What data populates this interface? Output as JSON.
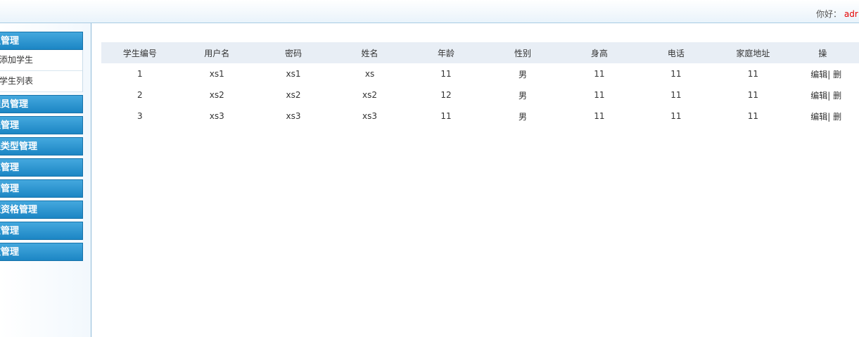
{
  "header": {
    "greeting": "你好：",
    "username": "adr"
  },
  "sidebar": {
    "menus": [
      {
        "label": "生管理",
        "children": [
          "添加学生",
          "学生列表"
        ]
      },
      {
        "label": "理员管理"
      },
      {
        "label": "程管理"
      },
      {
        "label": "程类型管理"
      },
      {
        "label": "练管理"
      },
      {
        "label": "团管理"
      },
      {
        "label": "应资格管理"
      },
      {
        "label": "室管理"
      },
      {
        "label": "教管理"
      }
    ]
  },
  "table": {
    "columns": [
      "学生编号",
      "用户名",
      "密码",
      "姓名",
      "年龄",
      "性别",
      "身高",
      "电话",
      "家庭地址",
      "操"
    ],
    "rows": [
      [
        "1",
        "xs1",
        "xs1",
        "xs",
        "11",
        "男",
        "11",
        "11",
        "11"
      ],
      [
        "2",
        "xs2",
        "xs2",
        "xs2",
        "12",
        "男",
        "11",
        "11",
        "11"
      ],
      [
        "3",
        "xs3",
        "xs3",
        "xs3",
        "11",
        "男",
        "11",
        "11",
        "11"
      ]
    ],
    "edit_label": "编辑",
    "separator": "|",
    "delete_label": "删"
  }
}
